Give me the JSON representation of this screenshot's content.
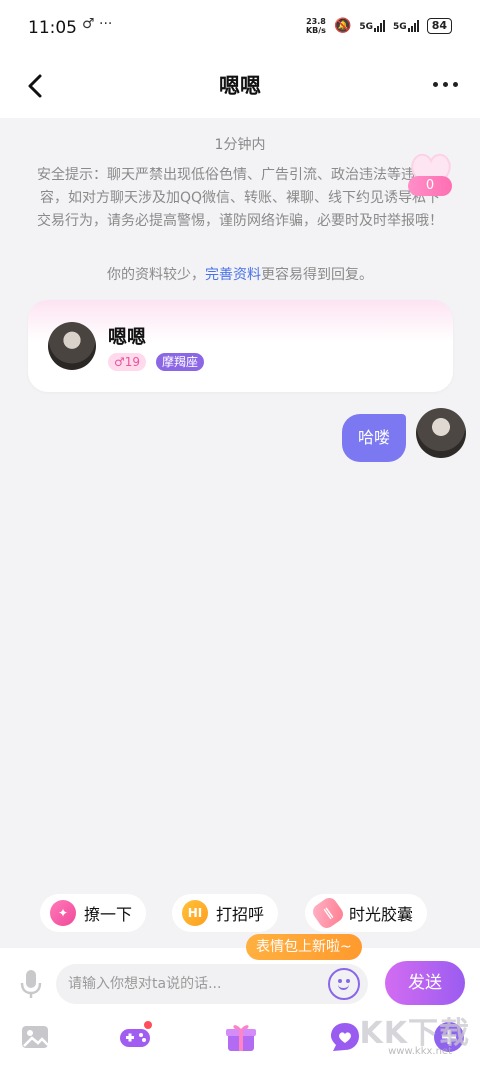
{
  "status_bar": {
    "time": "11:05",
    "extra_icons": "♂ ···",
    "net_speed_value": "23.8",
    "net_speed_unit": "KB/s",
    "sim1": "5G",
    "sim2": "5G",
    "battery": "84"
  },
  "nav": {
    "title": "嗯嗯",
    "back_icon": "chevron-left-icon",
    "more_icon": "more-dots-icon"
  },
  "chat": {
    "timestamp": "1分钟内",
    "safety_notice": "安全提示：聊天严禁出现低俗色情、广告引流、政治违法等违规内容，如对方聊天涉及加QQ微信、转账、裸聊、线下约见诱导私下交易行为，请务必提高警惕，谨防网络诈骗，必要时及时举报哦！",
    "profile_tip_prefix": "你的资料较少，",
    "profile_tip_link": "完善资料",
    "profile_tip_suffix": "更容易得到回复。",
    "heart_count": "0"
  },
  "user_card": {
    "name": "嗯嗯",
    "age": "♂19",
    "zodiac": "摩羯座"
  },
  "messages": [
    {
      "text": "哈喽",
      "from": "me"
    }
  ],
  "quick_actions": [
    {
      "label": "撩一下",
      "icon": "flirt-icon"
    },
    {
      "label": "打招呼",
      "icon": "hi-icon"
    },
    {
      "label": "时光胶囊",
      "icon": "time-capsule-icon"
    }
  ],
  "input": {
    "placeholder": "请输入你想对ta说的话...",
    "emoji_tip": "表情包上新啦~",
    "send_label": "发送"
  },
  "toolbar": [
    "image-icon",
    "game-icon",
    "gift-icon",
    "heart-chat-icon",
    "plus-icon"
  ],
  "watermark": {
    "text": "KK下载",
    "url": "www.kkx.net"
  },
  "colors": {
    "accent": "#7b78f2",
    "send_gradient_start": "#d36cf2",
    "send_gradient_end": "#9b5cf0",
    "link": "#4a72e8",
    "tip_orange": "#ff9a2e"
  }
}
